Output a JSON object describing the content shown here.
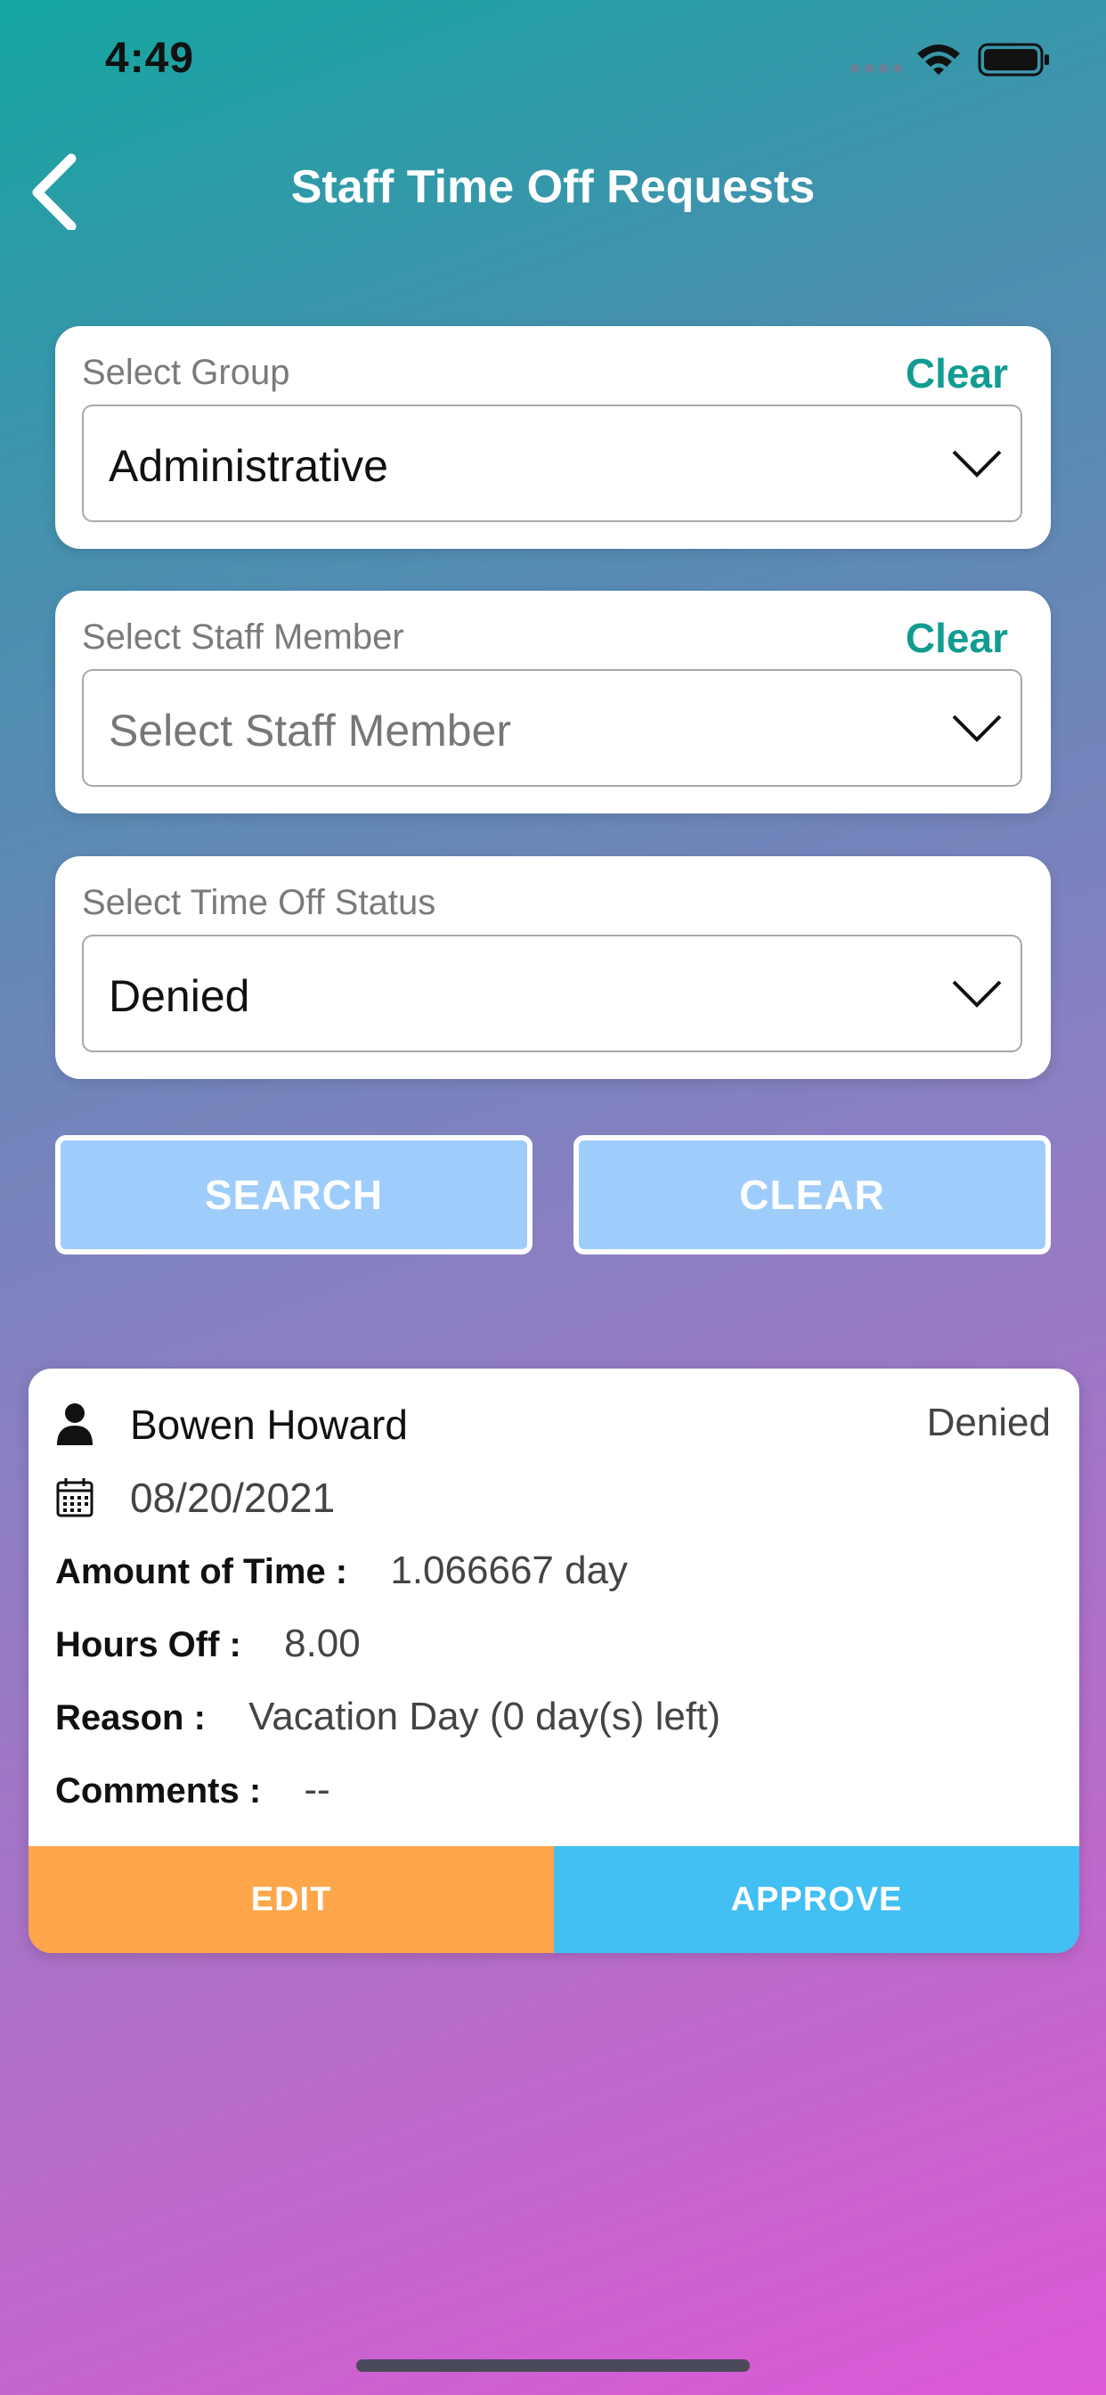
{
  "status_bar": {
    "time": "4:49"
  },
  "header": {
    "title": "Staff Time Off Requests"
  },
  "filters": {
    "group": {
      "label": "Select Group",
      "clear_label": "Clear",
      "value": "Administrative"
    },
    "staff": {
      "label": "Select Staff Member",
      "clear_label": "Clear",
      "placeholder": "Select Staff Member"
    },
    "status": {
      "label": "Select Time Off Status",
      "value": "Denied"
    }
  },
  "buttons": {
    "search": "SEARCH",
    "clear": "CLEAR"
  },
  "request": {
    "name": "Bowen Howard",
    "status": "Denied",
    "date": "08/20/2021",
    "amount_label": "Amount of Time :",
    "amount_value": "1.066667 day",
    "hours_label": "Hours Off :",
    "hours_value": "8.00",
    "reason_label": "Reason :",
    "reason_value": "Vacation Day (0 day(s) left)",
    "comments_label": "Comments :",
    "comments_value": "--",
    "edit_label": "EDIT",
    "approve_label": "APPROVE"
  }
}
